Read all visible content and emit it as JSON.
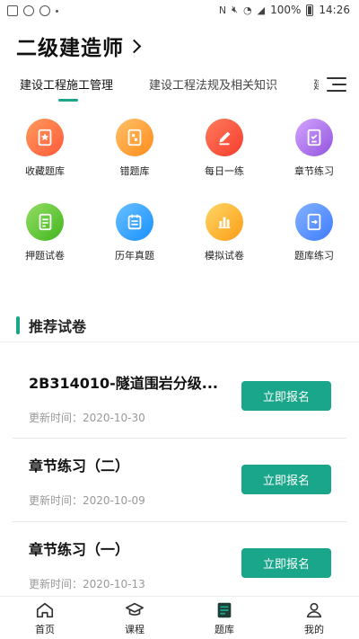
{
  "statusbar": {
    "battery": "100%",
    "time": "14:26"
  },
  "header": {
    "title": "二级建造师"
  },
  "tabs": [
    {
      "label": "建设工程施工管理",
      "active": true
    },
    {
      "label": "建设工程法规及相关知识",
      "active": false
    },
    {
      "label": "建设工程经济",
      "active": false
    }
  ],
  "grid": [
    {
      "label": "收藏题库",
      "icon": "favorite-icon",
      "color": "#ff7a45"
    },
    {
      "label": "错题库",
      "icon": "wrong-answers-icon",
      "color": "#ffa940"
    },
    {
      "label": "每日一练",
      "icon": "pencil-icon",
      "color": "#ff5a3c"
    },
    {
      "label": "章节练习",
      "icon": "chapter-practice-icon",
      "color": "#b37feb"
    },
    {
      "label": "押题试卷",
      "icon": "predict-paper-icon",
      "color": "#52c41a"
    },
    {
      "label": "历年真题",
      "icon": "past-papers-icon",
      "color": "#40a9ff"
    },
    {
      "label": "模拟试卷",
      "icon": "bar-chart-icon",
      "color": "#ffb61e"
    },
    {
      "label": "题库练习",
      "icon": "question-bank-icon",
      "color": "#4c8dff"
    }
  ],
  "section": {
    "title": "推荐试卷"
  },
  "papers": [
    {
      "title": "2B314010-隧道围岩分级...",
      "date": "更新时间：2020-10-30",
      "button": "立即报名"
    },
    {
      "title": "章节练习（二）",
      "date": "更新时间：2020-10-09",
      "button": "立即报名"
    },
    {
      "title": "章节练习（一）",
      "date": "更新时间：2020-10-13",
      "button": "立即报名"
    }
  ],
  "nav": [
    {
      "label": "首页",
      "icon": "home-icon"
    },
    {
      "label": "课程",
      "icon": "course-icon"
    },
    {
      "label": "题库",
      "icon": "question-bank-icon",
      "active": true
    },
    {
      "label": "我的",
      "icon": "profile-icon"
    }
  ],
  "accent": "#1aa68a"
}
